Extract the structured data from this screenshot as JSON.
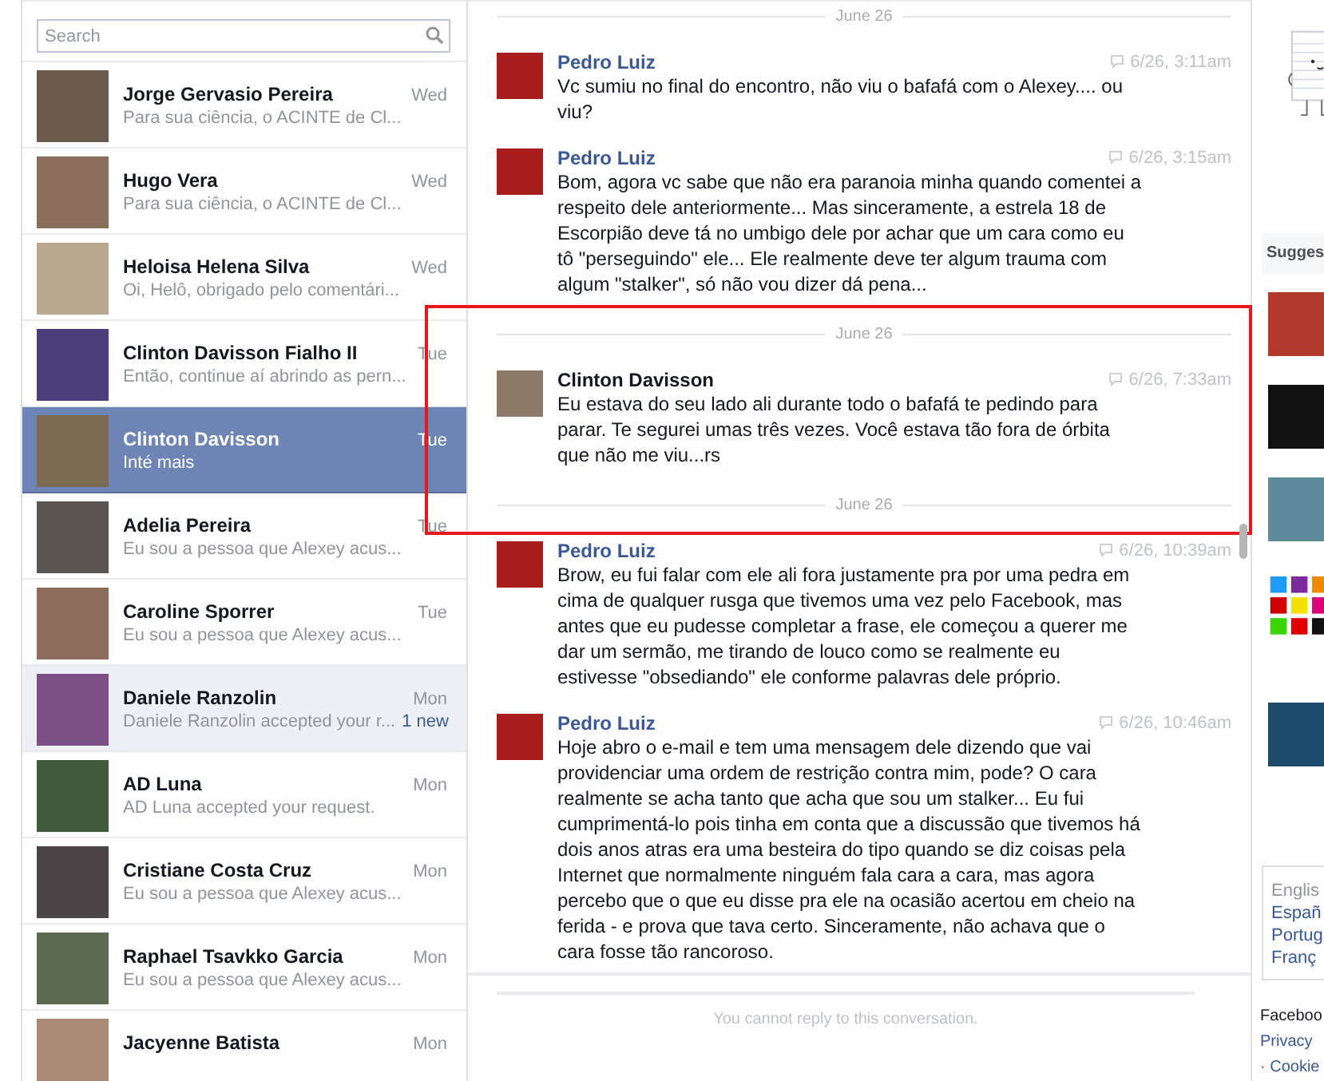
{
  "search": {
    "placeholder": "Search"
  },
  "conversations": [
    {
      "name": "Jorge Gervasio Pereira",
      "preview": "Para sua ciência, o ACINTE de Cl...",
      "time": "Wed",
      "selected": false,
      "unread": false
    },
    {
      "name": "Hugo Vera",
      "preview": "Para sua ciência, o ACINTE de Cl...",
      "time": "Wed",
      "selected": false,
      "unread": false
    },
    {
      "name": "Heloisa Helena Silva",
      "preview": "Oi, Helô, obrigado pelo comentári...",
      "time": "Wed",
      "selected": false,
      "unread": false
    },
    {
      "name": "Clinton Davisson Fialho II",
      "preview": "Então, continue aí abrindo as pern...",
      "time": "Tue",
      "selected": false,
      "unread": false
    },
    {
      "name": "Clinton Davisson",
      "preview": "Inté mais",
      "time": "Tue",
      "selected": true,
      "unread": false
    },
    {
      "name": "Adelia Pereira",
      "preview": "Eu sou a pessoa que Alexey acus...",
      "time": "Tue",
      "selected": false,
      "unread": false
    },
    {
      "name": "Caroline Sporrer",
      "preview": "Eu sou a pessoa que Alexey acus...",
      "time": "Tue",
      "selected": false,
      "unread": false
    },
    {
      "name": "Daniele Ranzolin",
      "preview": "Daniele Ranzolin accepted your r...",
      "time": "Mon",
      "selected": false,
      "unread": true,
      "new_count": "1 new"
    },
    {
      "name": "AD Luna",
      "preview": "AD Luna accepted your request.",
      "time": "Mon",
      "selected": false,
      "unread": false
    },
    {
      "name": "Cristiane Costa Cruz",
      "preview": "Eu sou a pessoa que Alexey acus...",
      "time": "Mon",
      "selected": false,
      "unread": false
    },
    {
      "name": "Raphael Tsavkko Garcia",
      "preview": "Eu sou a pessoa que Alexey acus...",
      "time": "Mon",
      "selected": false,
      "unread": false
    },
    {
      "name": "Jacyenne Batista",
      "time": "Mon",
      "selected": false,
      "unread": false
    }
  ],
  "thread": {
    "items": [
      {
        "kind": "day",
        "label": "June 26"
      },
      {
        "kind": "message",
        "author": "Pedro Luiz",
        "own": false,
        "time": "6/26, 3:11am",
        "text": "Vc sumiu no final do encontro, não viu o bafafá com o Alexey.... ou viu?"
      },
      {
        "kind": "message",
        "author": "Pedro Luiz",
        "own": false,
        "time": "6/26, 3:15am",
        "text": "Bom, agora vc sabe que não era paranoia minha quando comentei a respeito dele anteriormente... Mas sinceramente, a estrela 18 de Escorpião deve tá no umbigo dele por achar que um cara como eu tô \"perseguindo\" ele... Ele realmente deve ter algum trauma com algum \"stalker\", só não vou dizer dá pena..."
      },
      {
        "kind": "day",
        "label": "June 26"
      },
      {
        "kind": "message",
        "author": "Clinton Davisson",
        "own": true,
        "time": "6/26, 7:33am",
        "text": "Eu estava do seu lado ali durante todo o bafafá te pedindo para parar. Te segurei umas três vezes. Você estava tão fora de órbita que não me viu...rs",
        "highlighted": true
      },
      {
        "kind": "day",
        "label": "June 26"
      },
      {
        "kind": "message",
        "author": "Pedro Luiz",
        "own": false,
        "time": "6/26, 10:39am",
        "text": "Brow, eu fui falar com ele ali fora justamente pra por uma pedra em cima de qualquer rusga que tivemos uma vez pelo Facebook, mas antes que eu pudesse completar a frase, ele começou a querer me dar um sermão, me tirando de louco como se realmente eu estivesse \"obsediando\" ele conforme palavras dele próprio."
      },
      {
        "kind": "message",
        "author": "Pedro Luiz",
        "own": false,
        "time": "6/26, 10:46am",
        "text": "Hoje abro o e-mail e tem uma mensagem dele dizendo que vai providenciar uma ordem de restrição contra mim, pode? O cara realmente se acha tanto que acha que sou um stalker... Eu fui cumprimentá-lo pois tinha em conta que a discussão que tivemos há dois anos atras era uma besteira do tipo quando se diz coisas pela Internet que normalmente ninguém fala cara a cara, mas agora percebo que o que eu disse pra ele na ocasião acertou em cheio na ferida -  e prova que tava certo. Sinceramente, não achava que o cara fosse tão rancoroso."
      }
    ],
    "notice": "You cannot reply to this conversation."
  },
  "sidebar": {
    "heading": "Sugges",
    "languages": [
      "Englis",
      "Españ",
      "Portug",
      "Franç"
    ],
    "footer_links": [
      "Faceboo",
      "Privacy",
      "· Cookie"
    ]
  }
}
